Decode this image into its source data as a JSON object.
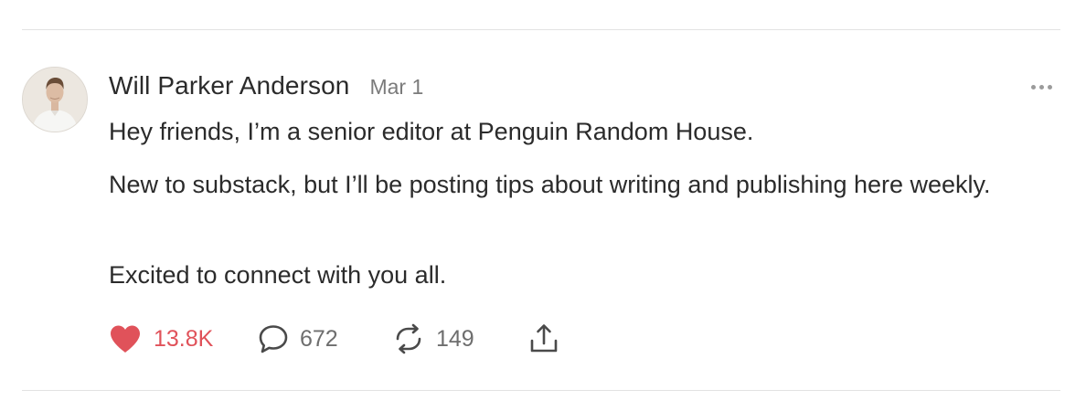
{
  "post": {
    "author": "Will Parker Anderson",
    "date": "Mar 1",
    "paragraphs": [
      "Hey friends, I’m a senior editor at Penguin Random House.",
      "New to substack, but I’ll be posting tips about writing and publishing here weekly.",
      "Excited to connect with you all."
    ],
    "actions": {
      "likes": "13.8K",
      "comments": "672",
      "restacks": "149"
    }
  },
  "icons": {
    "like": "heart-icon",
    "comment": "comment-bubble-icon",
    "restack": "restack-arrows-icon",
    "share": "share-icon",
    "more": "more-options-icon"
  },
  "colors": {
    "like_active": "#e0525a",
    "text": "#2b2b2b",
    "muted": "#7b7b7b",
    "divider": "#e3e3e3"
  }
}
